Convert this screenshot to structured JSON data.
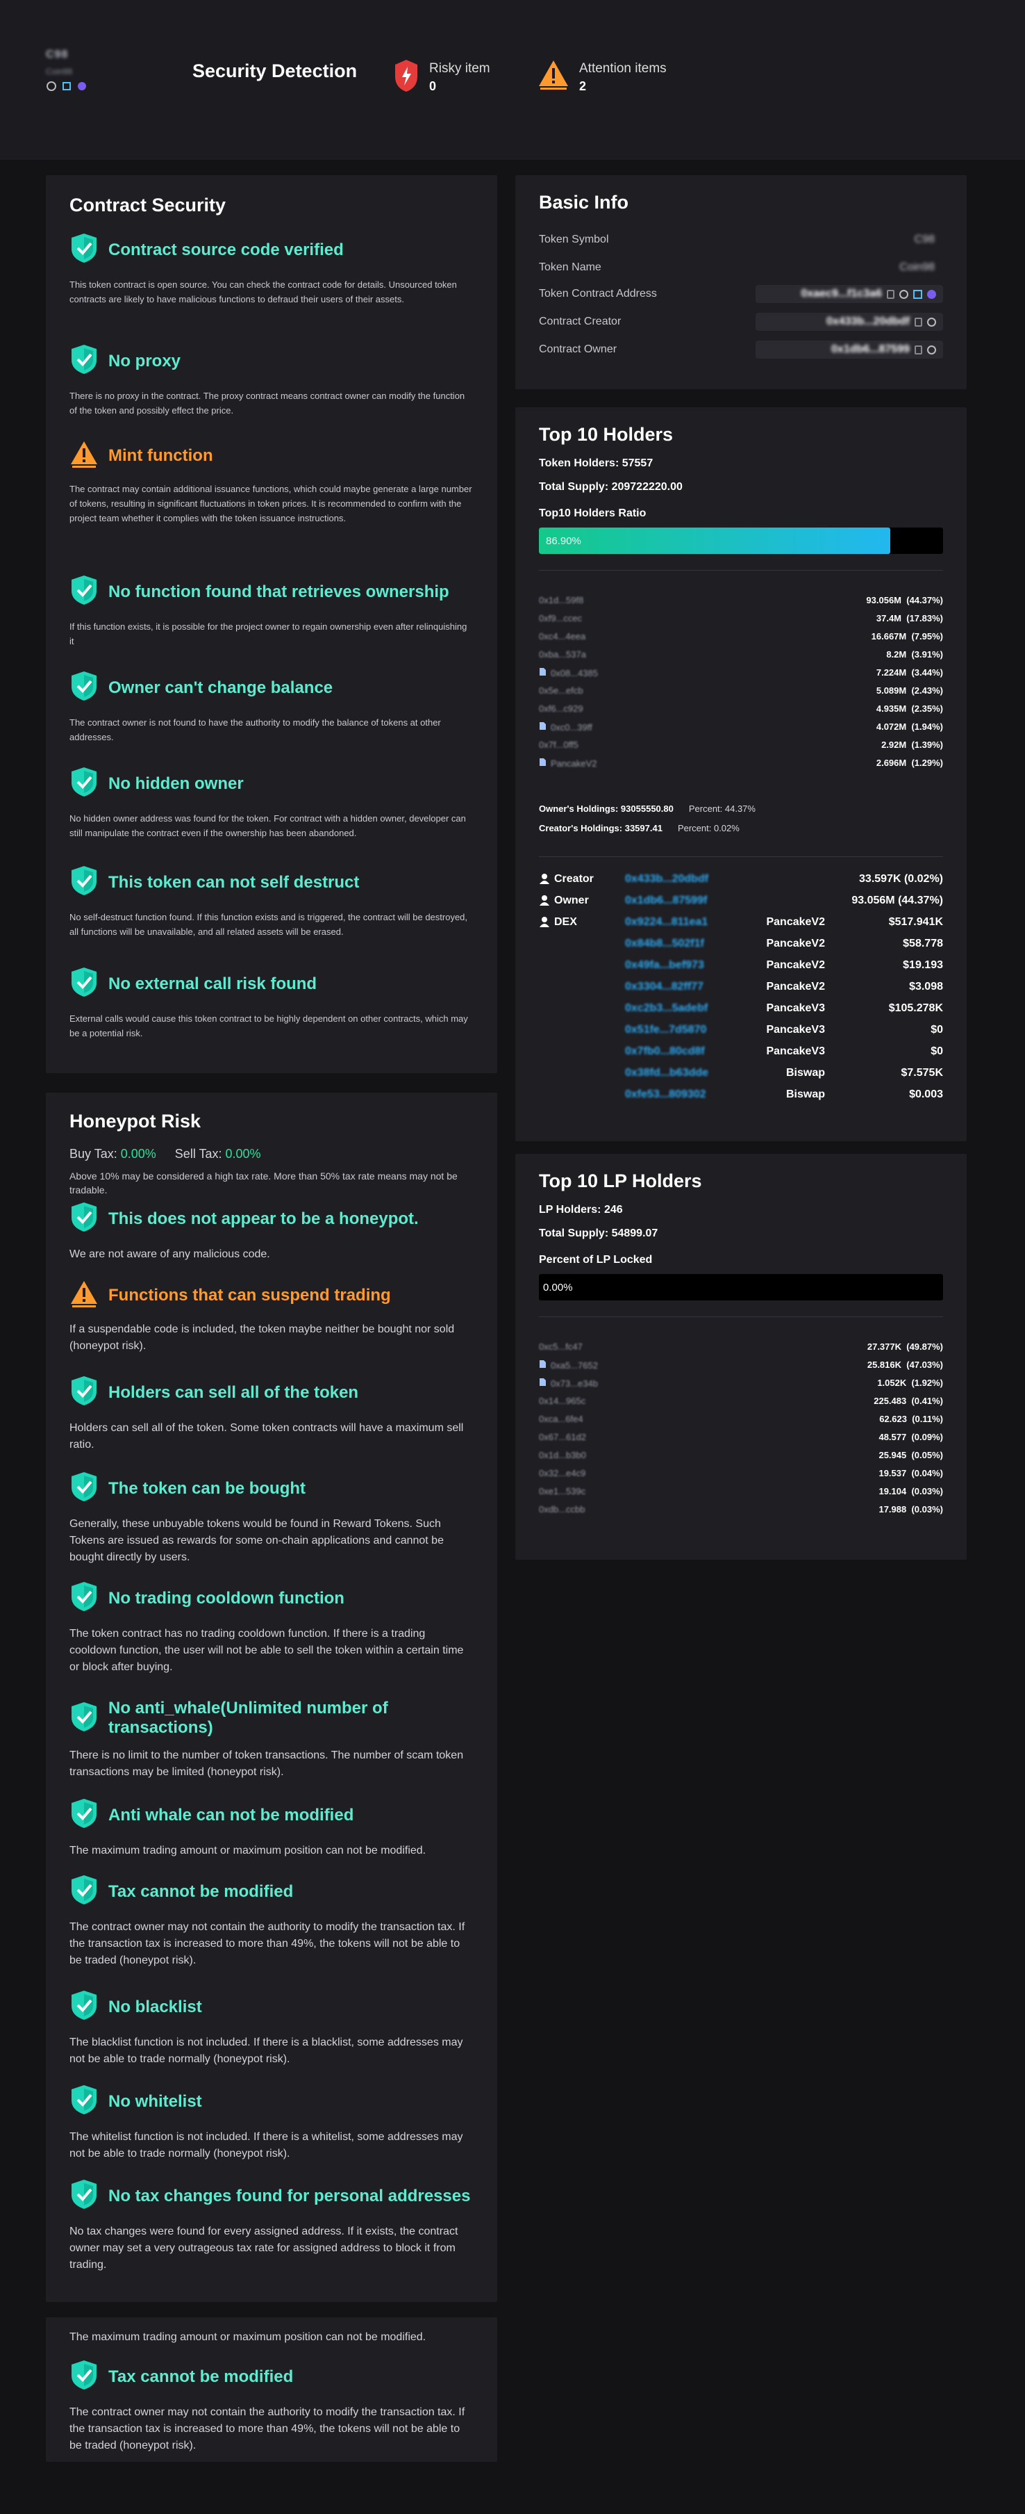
{
  "header": {
    "token_symbol": "C98",
    "token_name": "Coin98",
    "title": "Security Detection",
    "risky": {
      "label": "Risky item",
      "count": "0"
    },
    "attention": {
      "label": "Attention items",
      "count": "2"
    }
  },
  "colors": {
    "accent_ok": "#5eecd0",
    "accent_warn": "#ff9b2e",
    "address_blue": "#2eaaf2",
    "tax_green": "#2ee09a",
    "risk_red": "#e43b3b"
  },
  "contract_security": {
    "title": "Contract Security",
    "items": [
      {
        "status": "ok",
        "icon": "shield-check-icon",
        "title": "Contract source code verified",
        "desc": "This token contract is open source. You can check the contract code for details. Unsourced token contracts are likely to have malicious functions to defraud their users of their assets."
      },
      {
        "status": "ok",
        "icon": "shield-check-icon",
        "title": "No proxy",
        "desc": "There is no proxy in the contract. The proxy contract means contract owner can modify the function of the token and possibly effect the price."
      },
      {
        "status": "warn",
        "icon": "warning-icon",
        "title": "Mint function",
        "desc": "The contract may contain additional issuance functions, which could maybe generate a large number of tokens, resulting in significant fluctuations in token prices. It is recommended to confirm with the project team whether it complies with the token issuance instructions."
      },
      {
        "status": "ok",
        "icon": "shield-check-icon",
        "title": "No function found that retrieves ownership",
        "desc": "If this function exists, it is possible for the project owner to regain ownership even after relinquishing it"
      },
      {
        "status": "ok",
        "icon": "shield-check-icon",
        "title": "Owner can't change balance",
        "desc": "The contract owner is not found to have the authority to modify the balance of tokens at other addresses."
      },
      {
        "status": "ok",
        "icon": "shield-check-icon",
        "title": "No hidden owner",
        "desc": "No hidden owner address was found for the token. For contract with a hidden owner, developer can still manipulate the contract even if the ownership has been abandoned."
      },
      {
        "status": "ok",
        "icon": "shield-check-icon",
        "title": "This token can not self destruct",
        "desc": "No self-destruct function found. If this function exists and is triggered, the contract will be destroyed, all functions will be unavailable, and all related assets will be erased."
      },
      {
        "status": "ok",
        "icon": "shield-check-icon",
        "title": "No external call risk found",
        "desc": "External calls would cause this token contract to be highly dependent on other contracts, which may be a potential risk."
      }
    ]
  },
  "honeypot": {
    "title": "Honeypot Risk",
    "buy_tax_label": "Buy Tax:",
    "buy_tax": "0.00%",
    "sell_tax_label": "Sell Tax:",
    "sell_tax": "0.00%",
    "tax_note": "Above 10% may be considered a high tax rate. More than 50% tax rate means may not be tradable.",
    "items": [
      {
        "status": "ok",
        "icon": "shield-check-icon",
        "title": "This does not appear to be a honeypot.",
        "desc": "We are not aware of any malicious code."
      },
      {
        "status": "warn",
        "icon": "warning-icon",
        "title": "Functions that can suspend trading",
        "desc": "If a suspendable code is included, the token maybe neither be bought nor sold (honeypot risk)."
      },
      {
        "status": "ok",
        "icon": "shield-check-icon",
        "title": "Holders can sell all of the token",
        "desc": "Holders can sell all of the token. Some token contracts will have a maximum sell ratio."
      },
      {
        "status": "ok",
        "icon": "shield-check-icon",
        "title": "The token can be bought",
        "desc": "Generally, these unbuyable tokens would be found in Reward Tokens. Such Tokens are issued as rewards for some on-chain applications and cannot be bought directly by users."
      },
      {
        "status": "ok",
        "icon": "shield-check-icon",
        "title": "No trading cooldown function",
        "desc": "The token contract has no trading cooldown function. If there is a trading cooldown function, the user will not be able to sell the token within a certain time or block after buying."
      },
      {
        "status": "ok",
        "icon": "shield-check-icon",
        "title": "No anti_whale(Unlimited number of transactions)",
        "desc": "There is no limit to the number of token transactions. The number of scam token transactions may be limited (honeypot risk)."
      },
      {
        "status": "ok",
        "icon": "shield-check-icon",
        "title": "Anti whale can not be modified",
        "desc": "The maximum trading amount or maximum position can not be modified."
      },
      {
        "status": "ok",
        "icon": "shield-check-icon",
        "title": "Tax cannot be modified",
        "desc": "The contract owner may not contain the authority to modify the transaction tax. If the transaction tax is increased to more than 49%, the tokens will not be able to be traded (honeypot risk)."
      },
      {
        "status": "ok",
        "icon": "shield-check-icon",
        "title": "No blacklist",
        "desc": "The blacklist function is not included. If there is a blacklist, some addresses may not be able to trade normally (honeypot risk)."
      },
      {
        "status": "ok",
        "icon": "shield-check-icon",
        "title": "No whitelist",
        "desc": "The whitelist function is not included. If there is a whitelist, some addresses may not be able to trade normally (honeypot risk)."
      },
      {
        "status": "ok",
        "icon": "shield-check-icon",
        "title": "No tax changes found for personal addresses",
        "desc": "No tax changes were found for every assigned address. If it exists, the contract owner may set a very outrageous tax rate for assigned address to block it from trading."
      }
    ]
  },
  "extra": {
    "line": "The maximum trading amount or maximum position can not be modified.",
    "item": {
      "status": "ok",
      "icon": "shield-check-icon",
      "title": "Tax cannot be modified",
      "desc": "The contract owner may not contain the authority to modify the transaction tax. If the transaction tax is increased to more than 49%, the tokens will not be able to be traded (honeypot risk)."
    }
  },
  "basic_info": {
    "title": "Basic Info",
    "rows": [
      {
        "label": "Token Symbol",
        "value": "C98"
      },
      {
        "label": "Token Name",
        "value": "Coin98"
      },
      {
        "label": "Token Contract Address",
        "value": "0xaec9...f1c3a6"
      },
      {
        "label": "Contract Creator",
        "value": "0x433b...20dbdf"
      },
      {
        "label": "Contract Owner",
        "value": "0x1db6...87599"
      }
    ]
  },
  "top_holders": {
    "title": "Top 10 Holders",
    "holders_label": "Token Holders: 57557",
    "supply_label": "Total Supply: 209722220.00",
    "ratio_label": "Top10 Holders Ratio",
    "ratio": "86.90%",
    "ratio_value": 0.869,
    "list": [
      {
        "addr": "0x1d...59f8",
        "contract": false,
        "amount": "93.056M",
        "pct": "(44.37%)"
      },
      {
        "addr": "0xf9...ccec",
        "contract": false,
        "amount": "37.4M",
        "pct": "(17.83%)"
      },
      {
        "addr": "0xc4...4eea",
        "contract": false,
        "amount": "16.667M",
        "pct": "(7.95%)"
      },
      {
        "addr": "0xba...537a",
        "contract": false,
        "amount": "8.2M",
        "pct": "(3.91%)"
      },
      {
        "addr": "0x08...4385",
        "contract": true,
        "amount": "7.224M",
        "pct": "(3.44%)"
      },
      {
        "addr": "0x5e...efcb",
        "contract": false,
        "amount": "5.089M",
        "pct": "(2.43%)"
      },
      {
        "addr": "0xf6...c929",
        "contract": false,
        "amount": "4.935M",
        "pct": "(2.35%)"
      },
      {
        "addr": "0xc0...39ff",
        "contract": true,
        "amount": "4.072M",
        "pct": "(1.94%)"
      },
      {
        "addr": "0x7f...0ff5",
        "contract": false,
        "amount": "2.92M",
        "pct": "(1.39%)"
      },
      {
        "addr": "PancakeV2",
        "contract": true,
        "amount": "2.696M",
        "pct": "(1.29%)"
      }
    ],
    "owner_holdings": "Owner's Holdings: 93055550.80",
    "owner_percent": "Percent: 44.37%",
    "creator_holdings": "Creator's Holdings: 33597.41",
    "creator_percent": "Percent: 0.02%",
    "roles": [
      {
        "role": "Creator",
        "addr": "0x433b...20dbdf",
        "dex": "",
        "value": "33.597K (0.02%)"
      },
      {
        "role": "Owner",
        "addr": "0x1db6...87599f",
        "dex": "",
        "value": "93.056M (44.37%)"
      },
      {
        "role": "DEX",
        "addr": "0x9224...811ea1",
        "dex": "PancakeV2",
        "value": "$517.941K"
      },
      {
        "role": "",
        "addr": "0x84b8...502f1f",
        "dex": "PancakeV2",
        "value": "$58.778"
      },
      {
        "role": "",
        "addr": "0x49fa...bef973",
        "dex": "PancakeV2",
        "value": "$19.193"
      },
      {
        "role": "",
        "addr": "0x3304...82ff77",
        "dex": "PancakeV2",
        "value": "$3.098"
      },
      {
        "role": "",
        "addr": "0xc2b3...5adebf",
        "dex": "PancakeV3",
        "value": "$105.278K"
      },
      {
        "role": "",
        "addr": "0x51fe...7d5870",
        "dex": "PancakeV3",
        "value": "$0"
      },
      {
        "role": "",
        "addr": "0x7fb0...80cd8f",
        "dex": "PancakeV3",
        "value": "$0"
      },
      {
        "role": "",
        "addr": "0x38fd...b63dde",
        "dex": "Biswap",
        "value": "$7.575K"
      },
      {
        "role": "",
        "addr": "0xfe53...809302",
        "dex": "Biswap",
        "value": "$0.003"
      }
    ]
  },
  "lp_holders": {
    "title": "Top 10 LP Holders",
    "holders_label": "LP Holders: 246",
    "supply_label": "Total Supply: 54899.07",
    "locked_label": "Percent of LP Locked",
    "locked": "0.00%",
    "locked_value": 0,
    "list": [
      {
        "addr": "0xc5...fc47",
        "contract": false,
        "amount": "27.377K",
        "pct": "(49.87%)"
      },
      {
        "addr": "0xa5...7652",
        "contract": true,
        "amount": "25.816K",
        "pct": "(47.03%)"
      },
      {
        "addr": "0x73...e34b",
        "contract": true,
        "amount": "1.052K",
        "pct": "(1.92%)"
      },
      {
        "addr": "0x14...965c",
        "contract": false,
        "amount": "225.483",
        "pct": "(0.41%)"
      },
      {
        "addr": "0xca...6fe4",
        "contract": false,
        "amount": "62.623",
        "pct": "(0.11%)"
      },
      {
        "addr": "0x67...61d2",
        "contract": false,
        "amount": "48.577",
        "pct": "(0.09%)"
      },
      {
        "addr": "0x1d...b3b0",
        "contract": false,
        "amount": "25.945",
        "pct": "(0.05%)"
      },
      {
        "addr": "0x32...e4c9",
        "contract": false,
        "amount": "19.537",
        "pct": "(0.04%)"
      },
      {
        "addr": "0xe1...539c",
        "contract": false,
        "amount": "19.104",
        "pct": "(0.03%)"
      },
      {
        "addr": "0xdb...ccbb",
        "contract": false,
        "amount": "17.988",
        "pct": "(0.03%)"
      }
    ]
  }
}
